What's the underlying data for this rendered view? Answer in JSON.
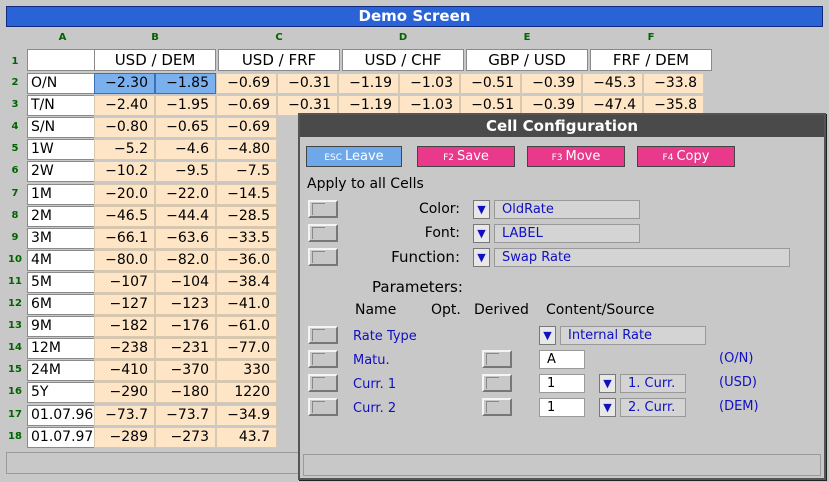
{
  "window_title": "Demo Screen",
  "columns": {
    "letters": [
      "A",
      "B",
      "C",
      "D",
      "E",
      "F"
    ],
    "headers": [
      "USD / DEM",
      "USD / FRF",
      "USD / CHF",
      "GBP / USD",
      "FRF / DEM"
    ]
  },
  "rows": [
    {
      "num": "1",
      "label": ""
    },
    {
      "num": "2",
      "label": "O/N",
      "values": [
        "−2.30",
        "−1.85",
        "−0.69",
        "−0.31",
        "−1.19",
        "−1.03",
        "−0.51",
        "−0.39",
        "−45.3",
        "−33.8"
      ]
    },
    {
      "num": "3",
      "label": "T/N",
      "values": [
        "−2.40",
        "−1.95",
        "−0.69",
        "−0.31",
        "−1.19",
        "−1.03",
        "−0.51",
        "−0.39",
        "−47.4",
        "−35.8"
      ]
    },
    {
      "num": "4",
      "label": "S/N",
      "values": [
        "−0.80",
        "−0.65",
        "−0.69"
      ]
    },
    {
      "num": "5",
      "label": "1W",
      "values": [
        "−5.2",
        "−4.6",
        "−4.80"
      ]
    },
    {
      "num": "6",
      "label": "2W",
      "values": [
        "−10.2",
        "−9.5",
        "−7.5"
      ]
    },
    {
      "num": "7",
      "label": "1M",
      "values": [
        "−20.0",
        "−22.0",
        "−14.5"
      ]
    },
    {
      "num": "8",
      "label": "2M",
      "values": [
        "−46.5",
        "−44.4",
        "−28.5"
      ]
    },
    {
      "num": "9",
      "label": "3M",
      "values": [
        "−66.1",
        "−63.6",
        "−33.5"
      ]
    },
    {
      "num": "10",
      "label": "4M",
      "values": [
        "−80.0",
        "−82.0",
        "−36.0"
      ]
    },
    {
      "num": "11",
      "label": "5M",
      "values": [
        "−107",
        "−104",
        "−38.4"
      ]
    },
    {
      "num": "12",
      "label": "6M",
      "values": [
        "−127",
        "−123",
        "−41.0"
      ]
    },
    {
      "num": "13",
      "label": "9M",
      "values": [
        "−182",
        "−176",
        "−61.0"
      ]
    },
    {
      "num": "14",
      "label": "12M",
      "values": [
        "−238",
        "−231",
        "−77.0"
      ]
    },
    {
      "num": "15",
      "label": "24M",
      "values": [
        "−410",
        "−370",
        "330"
      ]
    },
    {
      "num": "16",
      "label": "5Y",
      "values": [
        "−290",
        "−180",
        "1220"
      ]
    },
    {
      "num": "17",
      "label": "01.07.96",
      "values": [
        "−73.7",
        "−73.7",
        "−34.9"
      ]
    },
    {
      "num": "18",
      "label": "01.07.97",
      "values": [
        "−289",
        "−273",
        "43.7"
      ]
    }
  ],
  "dialog": {
    "title": "Cell Configuration",
    "buttons": [
      {
        "key": "ESC",
        "label": "Leave"
      },
      {
        "key": "F2",
        "label": "Save"
      },
      {
        "key": "F3",
        "label": "Move"
      },
      {
        "key": "F4",
        "label": "Copy"
      }
    ],
    "apply_all": "Apply to all Cells",
    "color_label": "Color:",
    "color_value": "OldRate",
    "font_label": "Font:",
    "font_value": "LABEL",
    "function_label": "Function:",
    "function_value": "Swap Rate",
    "parameters_title": "Parameters:",
    "param_headers": {
      "name": "Name",
      "opt": "Opt.",
      "derived": "Derived",
      "content": "Content/Source"
    },
    "params": [
      {
        "name": "Rate Type",
        "content": "Internal Rate"
      },
      {
        "name": "Matu.",
        "content": "A",
        "note": "(O/N)"
      },
      {
        "name": "Curr. 1",
        "content": "1",
        "source": "1. Curr.",
        "note": "(USD)"
      },
      {
        "name": "Curr. 2",
        "content": "1",
        "source": "2. Curr.",
        "note": "(DEM)"
      }
    ]
  }
}
